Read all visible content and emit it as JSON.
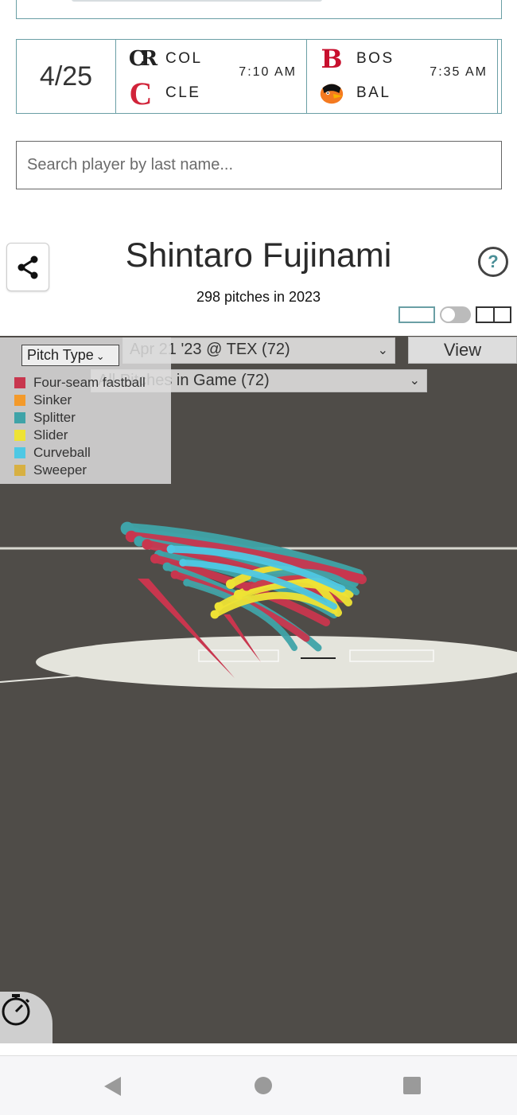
{
  "schedule": {
    "date": "4/25",
    "games": [
      {
        "team1": "COL",
        "team2": "CLE",
        "time": "7:10 AM",
        "logo1": "CR",
        "logo2": "C"
      },
      {
        "team1": "BOS",
        "team2": "BAL",
        "time": "7:35 AM",
        "logo1": "B",
        "logo2": "bird"
      }
    ]
  },
  "search": {
    "placeholder": "Search player by last name..."
  },
  "player": {
    "name": "Shintaro Fujinami",
    "pitch_summary": "298 pitches in 2023"
  },
  "help": {
    "label": "?"
  },
  "viz": {
    "game_select": "Apr 21 '23 @ TEX (72)",
    "pitches_select": "All Pitches in Game (72)",
    "view_button": "View",
    "pitch_type_select": "Pitch Type",
    "legend": [
      {
        "label": "Four-seam fastball",
        "color": "#c8364e"
      },
      {
        "label": "Sinker",
        "color": "#f39a2b"
      },
      {
        "label": "Splitter",
        "color": "#3fa3a8"
      },
      {
        "label": "Slider",
        "color": "#eee335"
      },
      {
        "label": "Curveball",
        "color": "#4ec8e4"
      },
      {
        "label": "Sweeper",
        "color": "#d7b042"
      }
    ]
  },
  "icons": {
    "share": "share-icon",
    "timer": "stopwatch-icon",
    "nav": [
      "back-icon",
      "home-icon",
      "recents-icon"
    ]
  }
}
